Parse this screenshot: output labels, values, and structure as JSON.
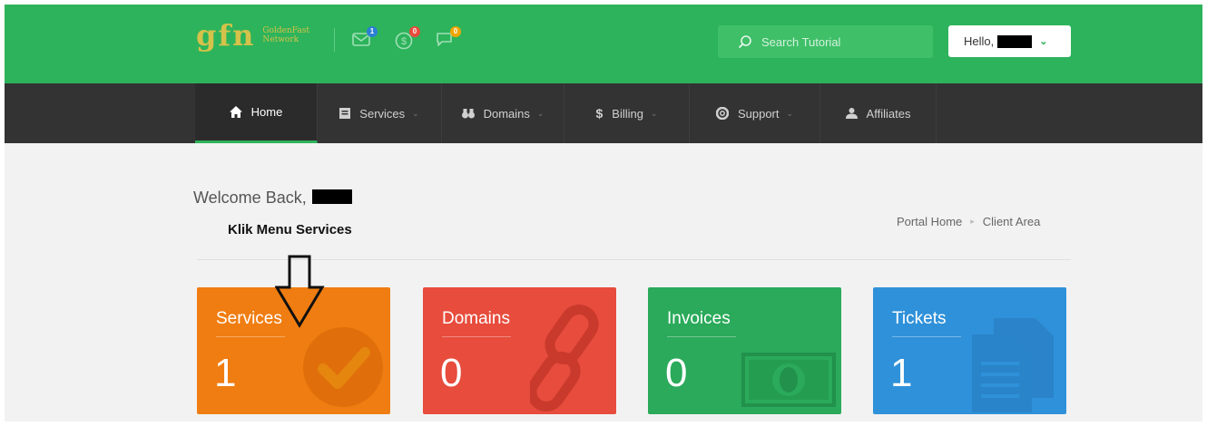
{
  "header": {
    "logo": {
      "mark": "gfn",
      "text": "GoldenFast Network"
    },
    "notifications": [
      {
        "name": "messages",
        "count": "1",
        "color": "#2b7fd3"
      },
      {
        "name": "billing",
        "count": "0",
        "color": "#e74c3c"
      },
      {
        "name": "chat",
        "count": "0",
        "color": "#f0a500"
      }
    ],
    "search_placeholder": "Search Tutorial",
    "user_greeting": "Hello,"
  },
  "nav": {
    "items": [
      {
        "label": "Home",
        "icon": "home-icon",
        "active": true
      },
      {
        "label": "Services",
        "icon": "list-icon",
        "dropdown": true
      },
      {
        "label": "Domains",
        "icon": "binoculars-icon",
        "dropdown": true
      },
      {
        "label": "Billing",
        "icon": "dollar-icon",
        "dropdown": true
      },
      {
        "label": "Support",
        "icon": "lifebuoy-icon",
        "dropdown": true
      },
      {
        "label": "Affiliates",
        "icon": "user-icon"
      }
    ]
  },
  "main": {
    "welcome": "Welcome Back,",
    "annotation": "Klik Menu Services",
    "breadcrumb": [
      "Portal Home",
      "Client Area"
    ],
    "tiles": [
      {
        "label": "Services",
        "count": "1",
        "color": "#f07d11",
        "icon": "check-circle-icon"
      },
      {
        "label": "Domains",
        "count": "0",
        "color": "#e74c3c",
        "icon": "chain-link-icon"
      },
      {
        "label": "Invoices",
        "count": "0",
        "color": "#2aaa5a",
        "icon": "money-icon"
      },
      {
        "label": "Tickets",
        "count": "1",
        "color": "#2f91d9",
        "icon": "documents-icon"
      }
    ]
  }
}
